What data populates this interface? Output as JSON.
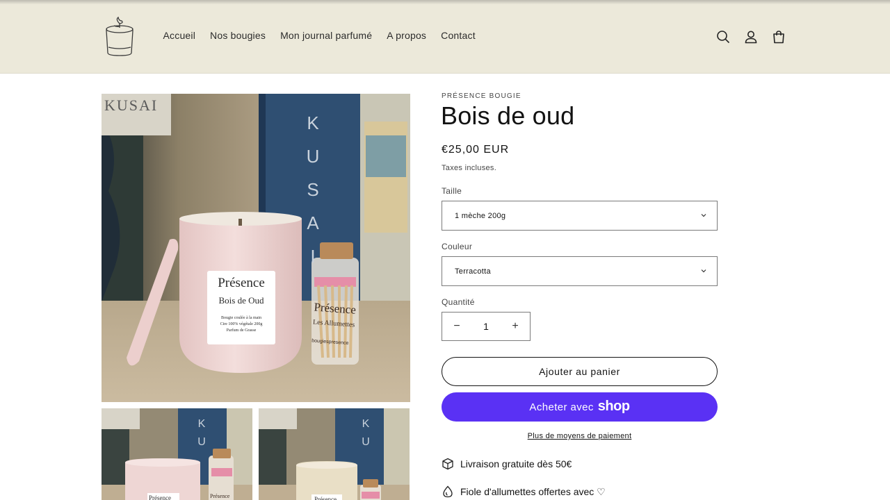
{
  "brand": {
    "logo_icon": "candle-logo-icon"
  },
  "nav": {
    "items": [
      {
        "label": "Accueil"
      },
      {
        "label": "Nos bougies"
      },
      {
        "label": "Mon journal parfumé"
      },
      {
        "label": "A propos"
      },
      {
        "label": "Contact"
      }
    ]
  },
  "header_icons": [
    "search-icon",
    "account-icon",
    "cart-icon"
  ],
  "product": {
    "vendor": "Présence Bougie",
    "title": "Bois de oud",
    "price": "€25,00 EUR",
    "tax_note": "Taxes incluses.",
    "size": {
      "label": "Taille",
      "selected": "1 mèche 200g"
    },
    "color": {
      "label": "Couleur",
      "selected": "Terracotta"
    },
    "quantity": {
      "label": "Quantité",
      "value": "1",
      "minus": "−",
      "plus": "+"
    },
    "add_to_cart": "Ajouter au panier",
    "buy_with": "Acheter avec",
    "buy_with_brand": "shop",
    "more_payment": "Plus de moyens de paiement",
    "features": [
      {
        "icon": "box-icon",
        "text": "Livraison gratuite dès 50€"
      },
      {
        "icon": "drop-icon",
        "text": "Fiole d'allumettes offertes avec ♡"
      }
    ]
  },
  "photo": {
    "label_brand": "Présence",
    "label_scent": "Bois de Oud",
    "label_line1": "Bougie coulée à la main",
    "label_line2": "Cire 100% végétale 200g",
    "label_line3": "Parfum de Grasse",
    "matches_brand": "Présence",
    "matches_name": "Les Allumettes",
    "matches_handle": "bougiespresence",
    "book_letters": [
      "K",
      "U",
      "S",
      "A",
      "I"
    ],
    "book_title": "KUSAI"
  },
  "colors": {
    "header_bg": "#ece9da",
    "accent_shop": "#5a31f4",
    "candle_pink": "#f0d8d6"
  }
}
